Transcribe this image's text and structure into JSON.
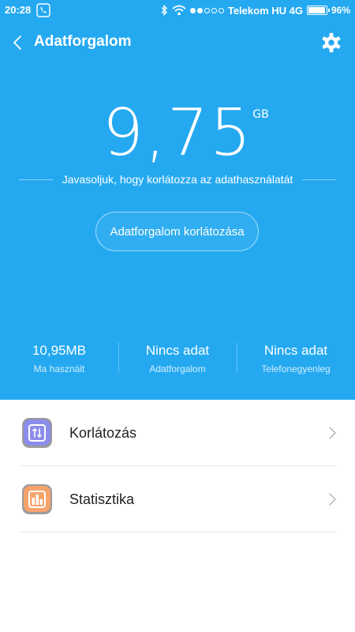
{
  "status_bar": {
    "time": "20:28",
    "carrier": "Telekom HU 4G",
    "battery": "96%",
    "battery_level": 0.96
  },
  "header": {
    "title": "Adatforgalom",
    "back_icon": "chevron-left-icon",
    "settings_icon": "gear-icon"
  },
  "usage": {
    "value": "9,75",
    "unit": "GB",
    "hint": "Javasoljuk, hogy korlátozza az adathasználatát",
    "limit_button": "Adatforgalom korlátozása"
  },
  "stats": [
    {
      "value": "10,95MB",
      "label": "Ma használt"
    },
    {
      "value": "Nincs adat",
      "label": "Adatforgalom"
    },
    {
      "value": "Nincs adat",
      "label": "Telefonegyenleg"
    }
  ],
  "menu": [
    {
      "label": "Korlátozás",
      "icon": "data-limit-icon"
    },
    {
      "label": "Statisztika",
      "icon": "statistics-icon"
    }
  ],
  "colors": {
    "accent": "#24a9f1",
    "limit_icon": "#8a8dea",
    "stats_icon": "#f7a36c"
  }
}
